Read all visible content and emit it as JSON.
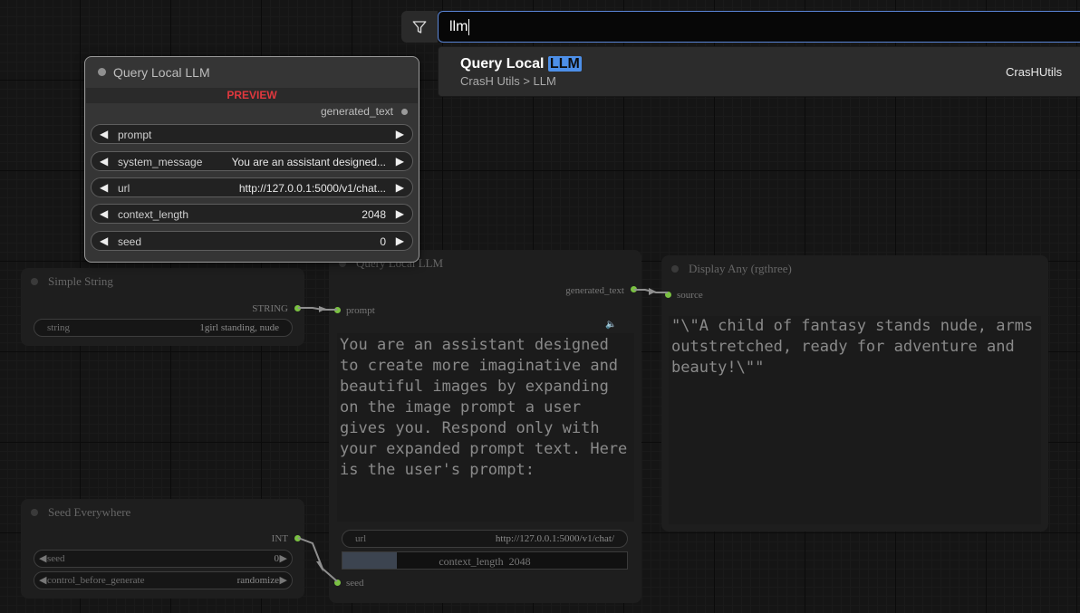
{
  "search": {
    "value": "llm",
    "result": {
      "title_prefix": "Query Local ",
      "title_match": "LLM",
      "category": "CrasH Utils > LLM",
      "source": "CrasHUtils"
    }
  },
  "preview_node": {
    "title": "Query Local LLM",
    "banner": "PREVIEW",
    "output": "generated_text",
    "widgets": [
      {
        "label": "prompt",
        "value": ""
      },
      {
        "label": "system_message",
        "value": "You are an assistant designed..."
      },
      {
        "label": "url",
        "value": "http://127.0.0.1:5000/v1/chat..."
      },
      {
        "label": "context_length",
        "value": "2048"
      },
      {
        "label": "seed",
        "value": "0"
      }
    ]
  },
  "simple_string": {
    "title": "Simple String",
    "output": "STRING",
    "widget_label": "string",
    "widget_value": "1girl standing, nude"
  },
  "seed_node": {
    "title": "Seed Everywhere",
    "output": "INT",
    "widgets": [
      {
        "label": "seed",
        "value": "0"
      },
      {
        "label": "control_before_generate",
        "value": "randomize"
      }
    ]
  },
  "query_node": {
    "title": "Query Local LLM",
    "output": "generated_text",
    "input_prompt": "prompt",
    "input_seed": "seed",
    "system_text": "You are an assistant designed to create more imaginative and beautiful images by expanding on the image prompt a user gives you. Respond only with your expanded prompt text. Here is the user's prompt:",
    "url_label": "url",
    "url_value": "http://127.0.0.1:5000/v1/chat/",
    "context_label": "context_length",
    "context_value": "2048",
    "context_fill": 0.19
  },
  "display_node": {
    "title": "Display Any (rgthree)",
    "input": "source",
    "text": "\"\\\"A child of fantasy stands nude, arms outstretched, ready for adventure and beauty!\\\"\""
  },
  "colors": {
    "accent": "#4d8fe8",
    "banner": "#e0383e",
    "link": "#7ac142"
  }
}
